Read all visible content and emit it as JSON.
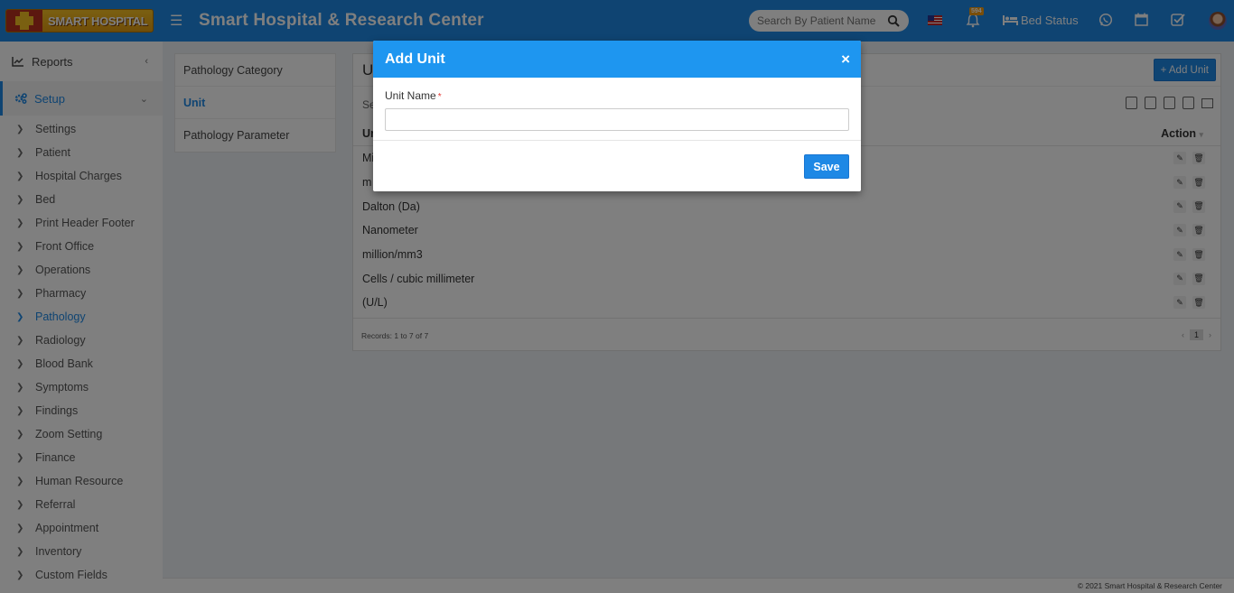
{
  "header": {
    "logo_text": "SMART HOSPITAL",
    "app_title": "Smart Hospital & Research Center",
    "search_placeholder": "Search By Patient Name",
    "notification_count": "594",
    "bed_status_label": "Bed Status"
  },
  "sidebar": {
    "reports_label": "Reports",
    "setup_label": "Setup",
    "items": [
      {
        "label": "Settings"
      },
      {
        "label": "Patient"
      },
      {
        "label": "Hospital Charges"
      },
      {
        "label": "Bed"
      },
      {
        "label": "Print Header Footer"
      },
      {
        "label": "Front Office"
      },
      {
        "label": "Operations"
      },
      {
        "label": "Pharmacy"
      },
      {
        "label": "Pathology"
      },
      {
        "label": "Radiology"
      },
      {
        "label": "Blood Bank"
      },
      {
        "label": "Symptoms"
      },
      {
        "label": "Findings"
      },
      {
        "label": "Zoom Setting"
      },
      {
        "label": "Finance"
      },
      {
        "label": "Human Resource"
      },
      {
        "label": "Referral"
      },
      {
        "label": "Appointment"
      },
      {
        "label": "Inventory"
      },
      {
        "label": "Custom Fields"
      }
    ]
  },
  "submenu": {
    "items": [
      "Pathology Category",
      "Unit",
      "Pathology Parameter"
    ]
  },
  "panel": {
    "title_partial": "Ui",
    "add_button": "+ Add Unit",
    "search_partial": "Se",
    "column_unit_partial": "Ur",
    "column_action": "Action",
    "rows": [
      {
        "name": "Mi"
      },
      {
        "name": "m"
      },
      {
        "name": "Dalton (Da)"
      },
      {
        "name": "Nanometer"
      },
      {
        "name": "million/mm3"
      },
      {
        "name": "Cells / cubic millimeter"
      },
      {
        "name": "(U/L)"
      }
    ],
    "records_text": "Records: 1 to 7 of 7",
    "page": "1"
  },
  "footer": {
    "copyright": "© 2021 Smart Hospital & Research Center"
  },
  "modal": {
    "title": "Add Unit",
    "close": "×",
    "field_label": "Unit Name",
    "required_mark": "*",
    "field_value": "",
    "save_label": "Save"
  }
}
